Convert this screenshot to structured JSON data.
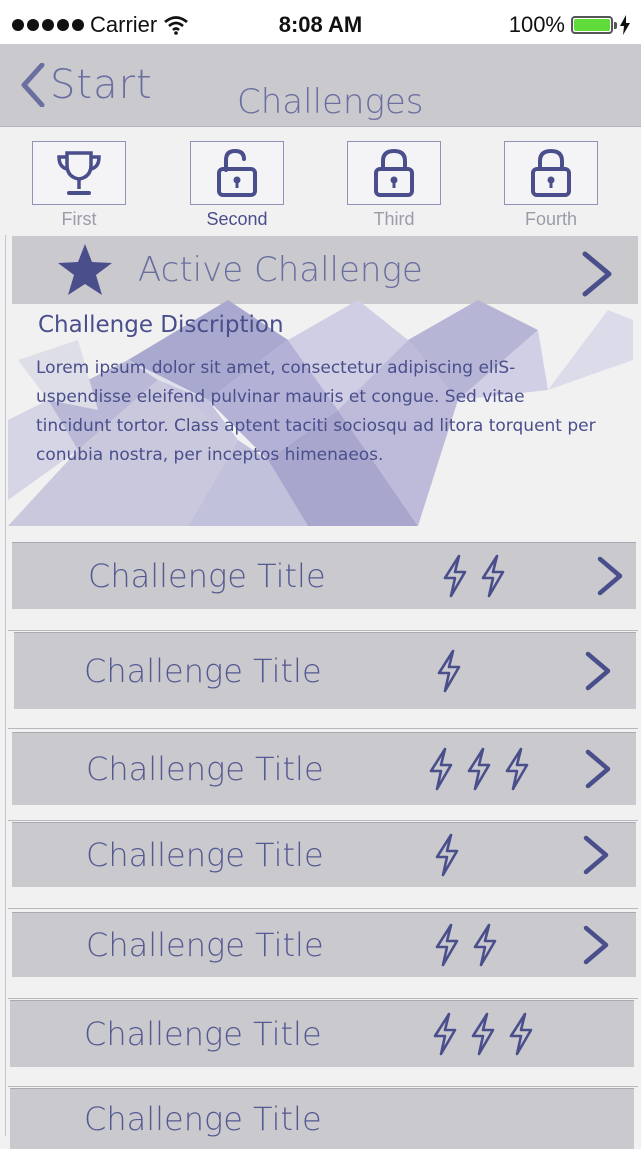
{
  "status_bar": {
    "carrier": "Carrier",
    "time": "8:08 AM",
    "battery": "100%",
    "battery_level": 1.0
  },
  "nav": {
    "back_label": "Start",
    "title": "Challenges"
  },
  "levels": [
    {
      "label": "First",
      "icon": "trophy-icon",
      "active": false
    },
    {
      "label": "Second",
      "icon": "unlock-icon",
      "active": true
    },
    {
      "label": "Third",
      "icon": "lock-icon",
      "active": false
    },
    {
      "label": "Fourth",
      "icon": "lock-icon",
      "active": false
    }
  ],
  "active_challenge": {
    "label": "Active Challenge",
    "icon": "star-icon"
  },
  "description": {
    "title": "Challenge Discription",
    "text": "Lorem ipsum dolor sit amet, consectetur adipiscing eliS-uspendisse eleifend pulvinar mauris et congue. Sed vitae tincidunt tortor. Class aptent taciti sociosqu ad litora torquent per conubia nostra, per inceptos himenaeos."
  },
  "challenges": [
    {
      "title": "Challenge Title",
      "bolts": 2,
      "chevron": true
    },
    {
      "title": "Challenge Title",
      "bolts": 1,
      "chevron": true
    },
    {
      "title": "Challenge Title",
      "bolts": 3,
      "chevron": true
    },
    {
      "title": "Challenge Title",
      "bolts": 1,
      "chevron": true
    },
    {
      "title": "Challenge Title",
      "bolts": 2,
      "chevron": true
    },
    {
      "title": "Challenge Title",
      "bolts": 3,
      "chevron": false
    },
    {
      "title": "Challenge Title",
      "bolts": 0,
      "chevron": false
    }
  ],
  "colors": {
    "accent": "#4a4f8c",
    "row_bg": "#c9c9ce",
    "page_bg": "#f1f1f2"
  }
}
